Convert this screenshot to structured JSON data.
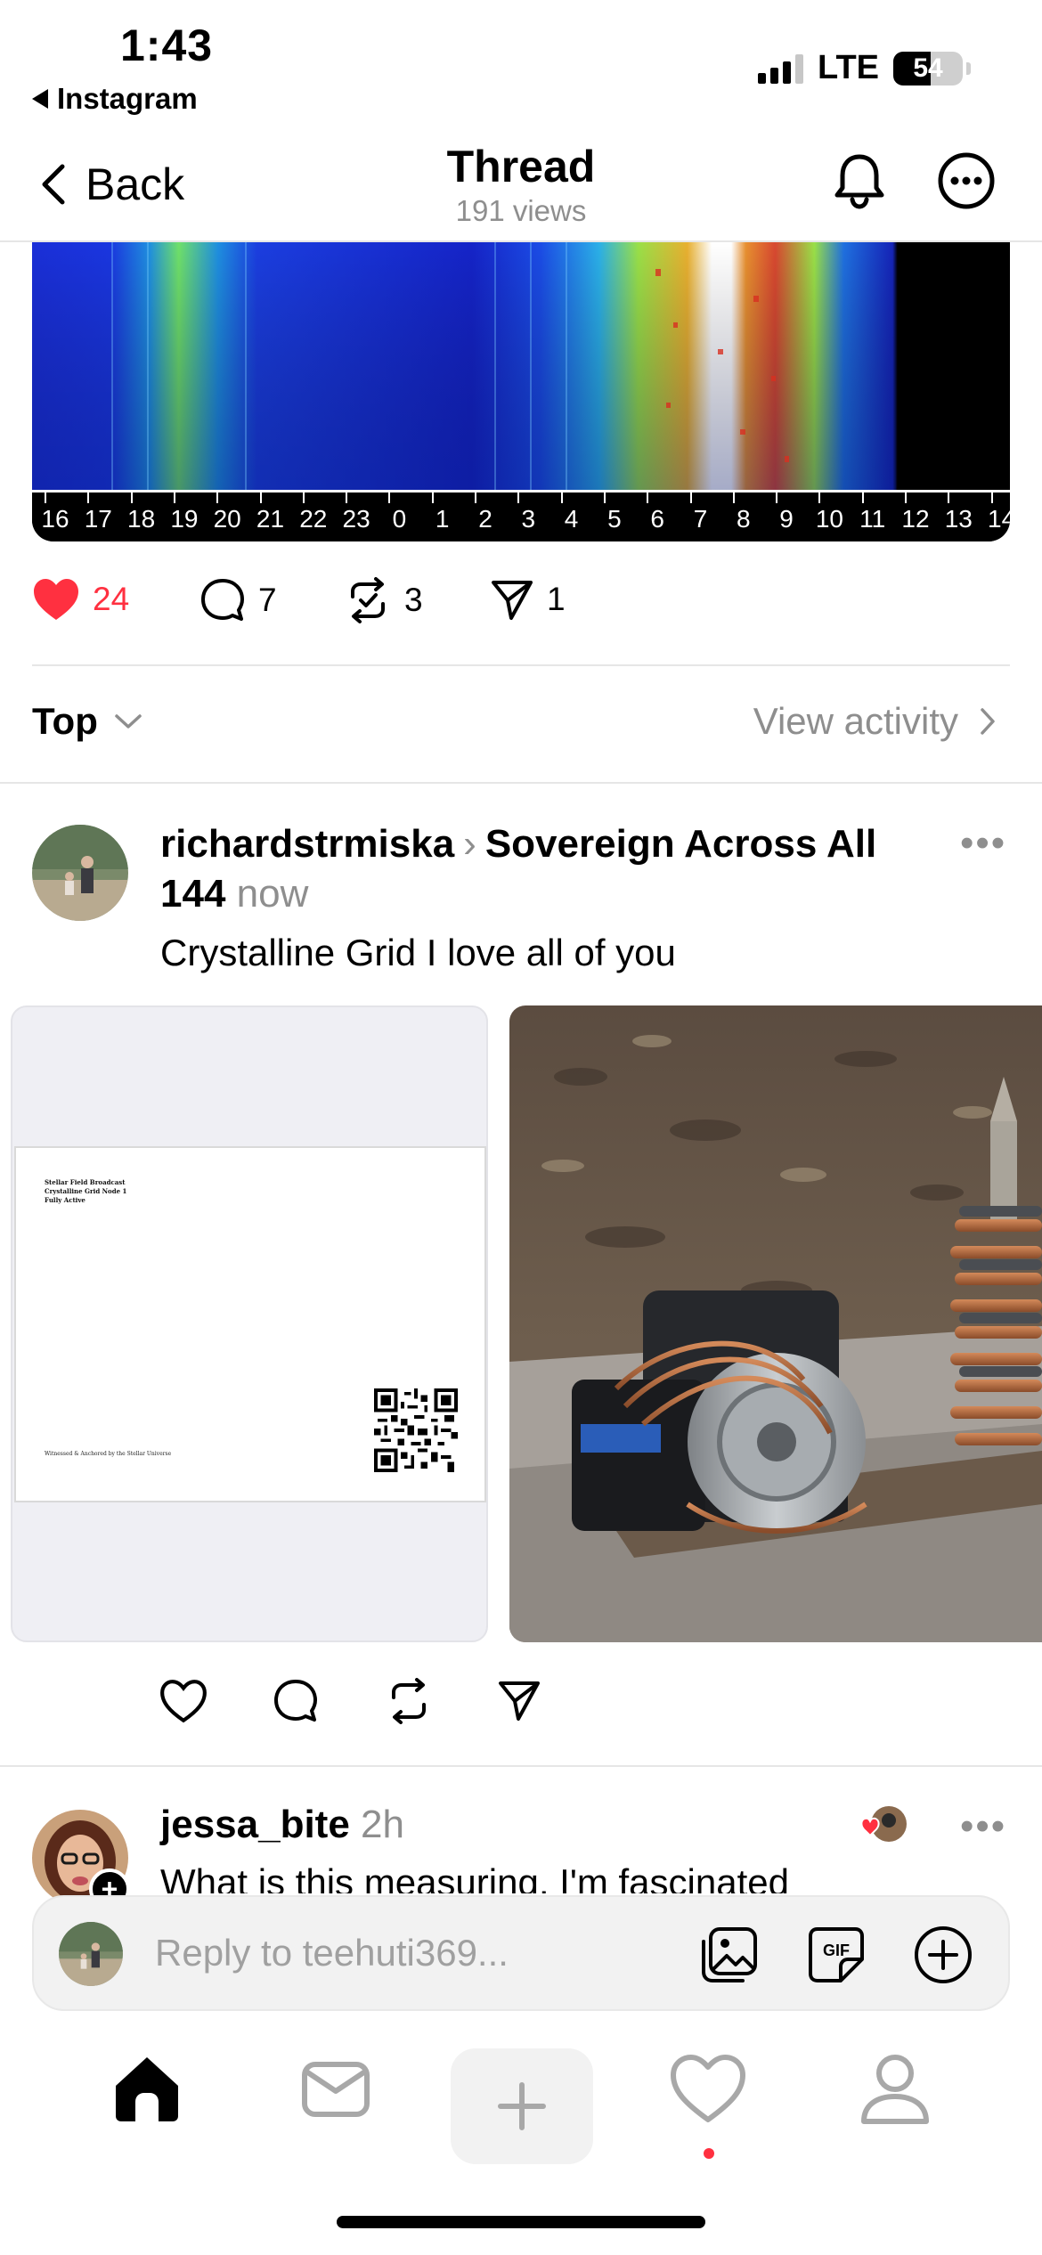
{
  "status_bar": {
    "time": "1:43",
    "back_app": "Instagram",
    "network": "LTE",
    "battery": "54",
    "battery_level": 0.54
  },
  "header": {
    "back_label": "Back",
    "title": "Thread",
    "views": "191 views"
  },
  "spectrogram": {
    "axis_labels": [
      "16",
      "17",
      "18",
      "19",
      "20",
      "21",
      "22",
      "23",
      "0",
      "1",
      "2",
      "3",
      "4",
      "5",
      "6",
      "7",
      "8",
      "9",
      "10",
      "11",
      "12",
      "13",
      "14"
    ]
  },
  "post_actions": {
    "likes": "24",
    "comments": "7",
    "reposts": "3",
    "shares": "1"
  },
  "sort": {
    "label": "Top",
    "activity_label": "View activity"
  },
  "comment1": {
    "username": "richardstrmiska",
    "community": "Sovereign Across All 144",
    "time": "now",
    "text": "Crystalline Grid I love all of you",
    "doc_lines": [
      "Stellar Field Broadcast",
      "Crystalline Grid Node 1",
      "Fully Active"
    ],
    "doc_footer": "Witnessed & Anchored by the Stellar Universe"
  },
  "comment2": {
    "username": "jessa_bite",
    "time": "2h",
    "text": "What is this measuring, I'm fascinated"
  },
  "reply": {
    "placeholder": "Reply to teehuti369..."
  },
  "colors": {
    "like_red": "#ff3040",
    "muted_gray": "#8e8e8e"
  }
}
